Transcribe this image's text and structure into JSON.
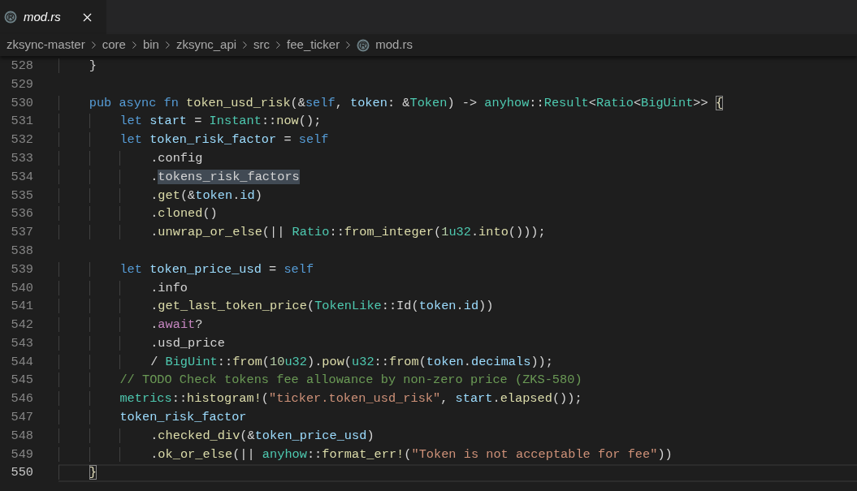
{
  "tab": {
    "title": "mod.rs",
    "preview": true,
    "selected": true
  },
  "breadcrumb": [
    {
      "label": "zksync-master",
      "kind": "folder"
    },
    {
      "label": "core",
      "kind": "folder"
    },
    {
      "label": "bin",
      "kind": "folder"
    },
    {
      "label": "zksync_api",
      "kind": "folder"
    },
    {
      "label": "src",
      "kind": "folder"
    },
    {
      "label": "fee_ticker",
      "kind": "folder"
    },
    {
      "label": "mod.rs",
      "kind": "file"
    }
  ],
  "editor": {
    "lines": [
      {
        "number": "528",
        "current": false,
        "tokens": [
          {
            "t": "    }",
            "kind": "plain"
          }
        ]
      },
      {
        "number": "529",
        "current": false
      },
      {
        "number": "530",
        "current": false,
        "tokens": [
          {
            "t": "    pub async fn ",
            "kind": "kw"
          },
          {
            "t": "token_usd_risk",
            "kind": "fn"
          },
          {
            "t": "(&",
            "kind": "plain"
          },
          {
            "t": "self",
            "kind": "kw"
          },
          {
            "t": ", ",
            "kind": "plain"
          },
          {
            "t": "token",
            "kind": "var"
          },
          {
            "t": ": &",
            "kind": "plain"
          },
          {
            "t": "Token",
            "kind": "type"
          },
          {
            "t": ") -> ",
            "kind": "plain"
          },
          {
            "t": "anyhow",
            "kind": "type"
          },
          {
            "t": "::",
            "kind": "plain"
          },
          {
            "t": "Result",
            "kind": "type"
          },
          {
            "t": "<",
            "kind": "plain"
          },
          {
            "t": "Ratio",
            "kind": "type"
          },
          {
            "t": "<",
            "kind": "plain"
          },
          {
            "t": "BigUint",
            "kind": "type"
          },
          {
            "t": ">> ",
            "kind": "plain"
          },
          {
            "t": "{",
            "kind": "bracket",
            "matched": true
          }
        ]
      },
      {
        "number": "531",
        "current": false,
        "tokens": [
          {
            "t": "        let ",
            "kind": "kw"
          },
          {
            "t": "start",
            "kind": "var"
          },
          {
            "t": " = ",
            "kind": "plain"
          },
          {
            "t": "Instant",
            "kind": "type"
          },
          {
            "t": "::",
            "kind": "plain"
          },
          {
            "t": "now",
            "kind": "fn"
          },
          {
            "t": "();",
            "kind": "plain"
          }
        ]
      },
      {
        "number": "532",
        "current": false,
        "tokens": [
          {
            "t": "        let ",
            "kind": "kw"
          },
          {
            "t": "token_risk_factor",
            "kind": "var"
          },
          {
            "t": " = ",
            "kind": "plain"
          },
          {
            "t": "self",
            "kind": "kw"
          }
        ]
      },
      {
        "number": "533",
        "current": false,
        "tokens": [
          {
            "t": "            .config",
            "kind": "plain"
          }
        ]
      },
      {
        "number": "534",
        "current": false,
        "tokens": [
          {
            "t": "            .",
            "kind": "plain"
          },
          {
            "t": "tokens_risk_factors",
            "kind": "plain",
            "highlighted": true
          }
        ]
      },
      {
        "number": "535",
        "current": false,
        "tokens": [
          {
            "t": "            .",
            "kind": "plain"
          },
          {
            "t": "get",
            "kind": "fn"
          },
          {
            "t": "(&",
            "kind": "plain"
          },
          {
            "t": "token",
            "kind": "var"
          },
          {
            "t": ".",
            "kind": "plain"
          },
          {
            "t": "id",
            "kind": "var"
          },
          {
            "t": ")",
            "kind": "plain"
          }
        ]
      },
      {
        "number": "536",
        "current": false,
        "tokens": [
          {
            "t": "            .",
            "kind": "plain"
          },
          {
            "t": "cloned",
            "kind": "fn"
          },
          {
            "t": "()",
            "kind": "plain"
          }
        ]
      },
      {
        "number": "537",
        "current": false,
        "tokens": [
          {
            "t": "            .",
            "kind": "plain"
          },
          {
            "t": "unwrap_or_else",
            "kind": "fn"
          },
          {
            "t": "(|| ",
            "kind": "plain"
          },
          {
            "t": "Ratio",
            "kind": "type"
          },
          {
            "t": "::",
            "kind": "plain"
          },
          {
            "t": "from_integer",
            "kind": "fn"
          },
          {
            "t": "(",
            "kind": "plain"
          },
          {
            "t": "1",
            "kind": "num"
          },
          {
            "t": "u32",
            "kind": "type"
          },
          {
            "t": ".",
            "kind": "plain"
          },
          {
            "t": "into",
            "kind": "fn"
          },
          {
            "t": "()));",
            "kind": "plain"
          }
        ]
      },
      {
        "number": "538",
        "current": false
      },
      {
        "number": "539",
        "current": false,
        "tokens": [
          {
            "t": "        let ",
            "kind": "kw"
          },
          {
            "t": "token_price_usd",
            "kind": "var"
          },
          {
            "t": " = ",
            "kind": "plain"
          },
          {
            "t": "self",
            "kind": "kw"
          }
        ]
      },
      {
        "number": "540",
        "current": false,
        "tokens": [
          {
            "t": "            .info",
            "kind": "plain"
          }
        ]
      },
      {
        "number": "541",
        "current": false,
        "tokens": [
          {
            "t": "            .",
            "kind": "plain"
          },
          {
            "t": "get_last_token_price",
            "kind": "fn"
          },
          {
            "t": "(",
            "kind": "plain"
          },
          {
            "t": "TokenLike",
            "kind": "type"
          },
          {
            "t": "::Id(",
            "kind": "plain"
          },
          {
            "t": "token",
            "kind": "var"
          },
          {
            "t": ".",
            "kind": "plain"
          },
          {
            "t": "id",
            "kind": "var"
          },
          {
            "t": "))",
            "kind": "plain"
          }
        ]
      },
      {
        "number": "542",
        "current": false,
        "tokens": [
          {
            "t": "            .",
            "kind": "plain"
          },
          {
            "t": "await",
            "kind": "ctrl"
          },
          {
            "t": "?",
            "kind": "plain"
          }
        ]
      },
      {
        "number": "543",
        "current": false,
        "tokens": [
          {
            "t": "            .usd_price",
            "kind": "plain"
          }
        ]
      },
      {
        "number": "544",
        "current": false,
        "tokens": [
          {
            "t": "            / ",
            "kind": "plain"
          },
          {
            "t": "BigUint",
            "kind": "type"
          },
          {
            "t": "::",
            "kind": "plain"
          },
          {
            "t": "from",
            "kind": "fn"
          },
          {
            "t": "(",
            "kind": "plain"
          },
          {
            "t": "10",
            "kind": "num"
          },
          {
            "t": "u32",
            "kind": "type"
          },
          {
            "t": ").",
            "kind": "plain"
          },
          {
            "t": "pow",
            "kind": "fn"
          },
          {
            "t": "(",
            "kind": "plain"
          },
          {
            "t": "u32",
            "kind": "type"
          },
          {
            "t": "::",
            "kind": "plain"
          },
          {
            "t": "from",
            "kind": "fn"
          },
          {
            "t": "(",
            "kind": "plain"
          },
          {
            "t": "token",
            "kind": "var"
          },
          {
            "t": ".",
            "kind": "plain"
          },
          {
            "t": "decimals",
            "kind": "var"
          },
          {
            "t": "));",
            "kind": "plain"
          }
        ]
      },
      {
        "number": "545",
        "current": false,
        "tokens": [
          {
            "t": "        // TODO Check tokens fee allowance by non-zero price (ZKS-580)",
            "kind": "comment"
          }
        ]
      },
      {
        "number": "546",
        "current": false,
        "tokens": [
          {
            "t": "        metrics",
            "kind": "type"
          },
          {
            "t": "::",
            "kind": "plain"
          },
          {
            "t": "histogram!",
            "kind": "fn"
          },
          {
            "t": "(",
            "kind": "plain"
          },
          {
            "t": "\"ticker.token_usd_risk\"",
            "kind": "str"
          },
          {
            "t": ", ",
            "kind": "plain"
          },
          {
            "t": "start",
            "kind": "var"
          },
          {
            "t": ".",
            "kind": "plain"
          },
          {
            "t": "elapsed",
            "kind": "fn"
          },
          {
            "t": "());",
            "kind": "plain"
          }
        ]
      },
      {
        "number": "547",
        "current": false,
        "tokens": [
          {
            "t": "        token_risk_factor",
            "kind": "var"
          }
        ]
      },
      {
        "number": "548",
        "current": false,
        "tokens": [
          {
            "t": "            .",
            "kind": "plain"
          },
          {
            "t": "checked_div",
            "kind": "fn"
          },
          {
            "t": "(&",
            "kind": "plain"
          },
          {
            "t": "token_price_usd",
            "kind": "var"
          },
          {
            "t": ")",
            "kind": "plain"
          }
        ]
      },
      {
        "number": "549",
        "current": false,
        "tokens": [
          {
            "t": "            .",
            "kind": "plain"
          },
          {
            "t": "ok_or_else",
            "kind": "fn"
          },
          {
            "t": "(|| ",
            "kind": "plain"
          },
          {
            "t": "anyhow",
            "kind": "type"
          },
          {
            "t": "::",
            "kind": "plain"
          },
          {
            "t": "format_err!",
            "kind": "fn"
          },
          {
            "t": "(",
            "kind": "plain"
          },
          {
            "t": "\"Token is not acceptable for fee\"",
            "kind": "str"
          },
          {
            "t": "))",
            "kind": "plain"
          }
        ]
      },
      {
        "number": "550",
        "current": true,
        "tokens": [
          {
            "t": "    }",
            "kind": "bracket",
            "matched": true
          }
        ]
      }
    ]
  }
}
